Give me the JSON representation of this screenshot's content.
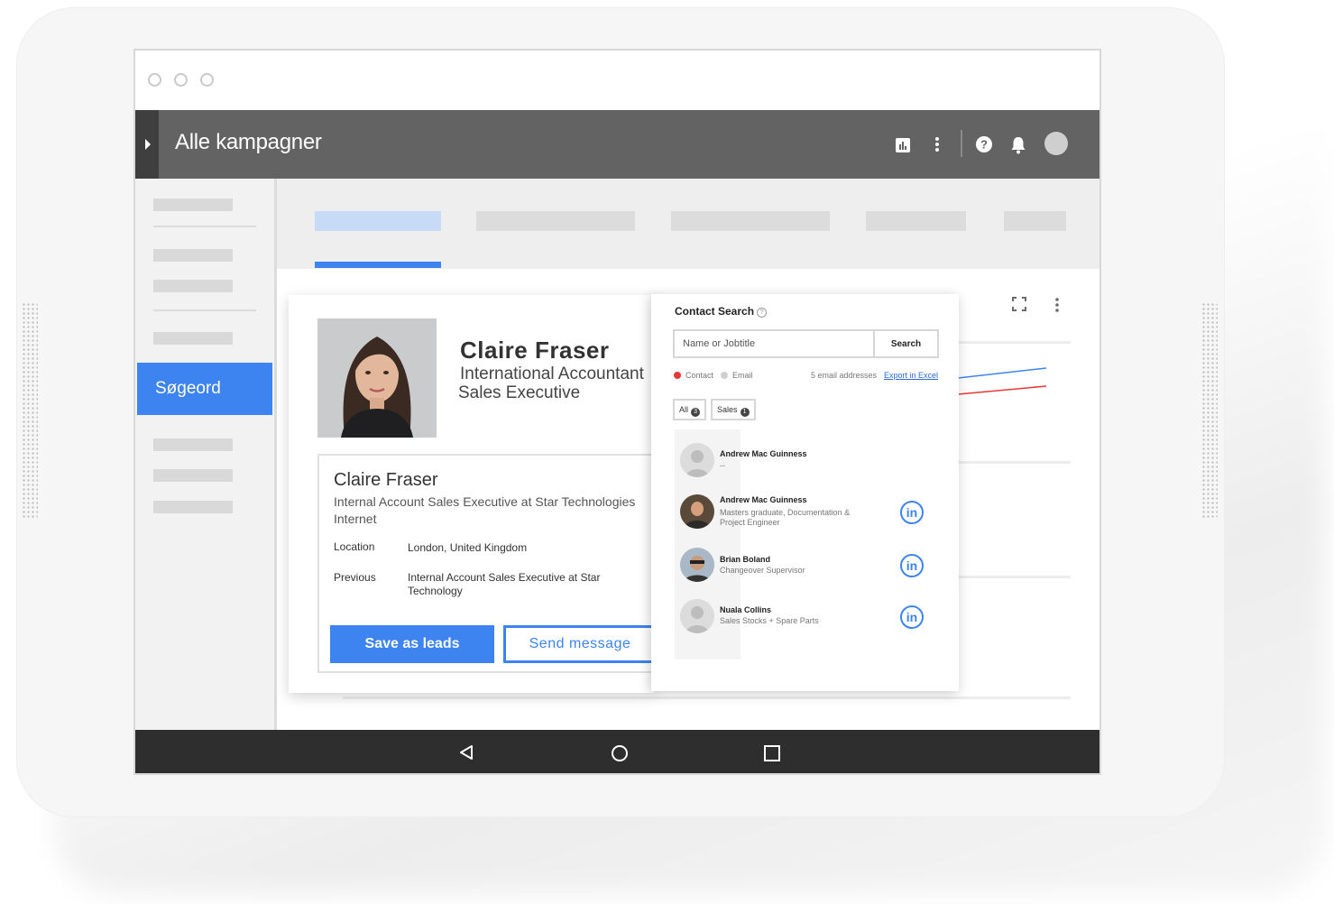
{
  "app": {
    "title": "Alle kampagner"
  },
  "sidebar": {
    "active_item": "Søgeord"
  },
  "profile": {
    "name": "Claire Fraser",
    "title_line1": "International Accountant",
    "title_line2": "Sales Executive",
    "card_name": "Claire Fraser",
    "headline": "Internal Account Sales Executive at Star Technologies Internet",
    "location_label": "Location",
    "location_value": "London, United Kingdom",
    "previous_label": "Previous",
    "previous_value": "Internal Account Sales Executive at Star Technology",
    "save_button": "Save as leads",
    "message_button": "Send message"
  },
  "contact_search": {
    "title": "Contact Search",
    "input_placeholder": "Name or Jobtitle",
    "search_button": "Search",
    "filter_contact": "Contact",
    "filter_email": "Email",
    "email_count": "5 email addresses",
    "export_link": "Export in Excel",
    "chips": [
      {
        "label": "All",
        "count": "3"
      },
      {
        "label": "Sales",
        "count": "1"
      }
    ],
    "results": [
      {
        "name": "Andrew Mac Guinness",
        "subtitle": "--",
        "has_linkedin": false
      },
      {
        "name": "Andrew Mac Guinness",
        "subtitle": "Masters graduate, Documentation & Project Engineer",
        "has_linkedin": true
      },
      {
        "name": "Brian Boland",
        "subtitle": "Changeover Supervisor",
        "has_linkedin": true
      },
      {
        "name": "Nuala Collins",
        "subtitle": "Sales Stocks + Spare Parts",
        "has_linkedin": true
      }
    ],
    "linkedin_glyph": "in"
  },
  "colors": {
    "accent": "#3d84f0",
    "appbar": "#636363",
    "navbar": "#2e2e2e",
    "filter_active": "#e53935"
  },
  "icons": [
    "chart-icon",
    "more-vert-icon",
    "help-icon",
    "bell-icon",
    "fullscreen-icon",
    "back-icon",
    "home-icon",
    "recents-icon",
    "linkedin-icon"
  ]
}
